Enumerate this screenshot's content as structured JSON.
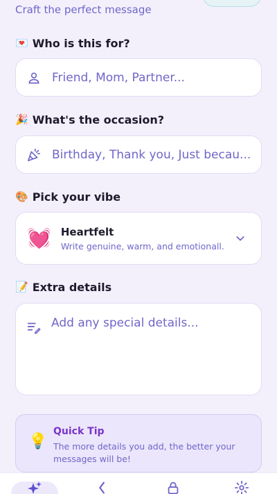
{
  "header": {
    "subtitle": "Craft the perfect message"
  },
  "recipient": {
    "label_emoji": "💌",
    "label": "Who is this for?",
    "placeholder": "Friend, Mom, Partner...",
    "icon": "person-icon"
  },
  "occasion": {
    "label_emoji": "🎉",
    "label": "What's the occasion?",
    "placeholder": "Birthday, Thank you, Just becau...",
    "icon": "party-popper-icon"
  },
  "vibe": {
    "label_emoji": "🎨",
    "label": "Pick your vibe",
    "selected_emoji": "💓",
    "selected_title": "Heartfelt",
    "selected_desc": "Write genuine, warm, and emotionall...",
    "icon": "chevron-down-icon"
  },
  "details": {
    "label_emoji": "📝",
    "label": "Extra details",
    "placeholder": "Add any special details...",
    "icon": "notes-edit-icon"
  },
  "tip": {
    "emoji": "💡",
    "title": "Quick Tip",
    "body": "The more details you add, the better your messages will be!"
  },
  "tabs": [
    {
      "icon": "sparkles-icon",
      "active": true
    },
    {
      "icon": "back-arrow-icon",
      "active": false
    },
    {
      "icon": "lock-icon",
      "active": false
    },
    {
      "icon": "settings-gear-icon",
      "active": false
    }
  ],
  "colors": {
    "accent": "#6f66c9",
    "background": "#f3f0fc",
    "tip_title": "#7a34c9"
  }
}
